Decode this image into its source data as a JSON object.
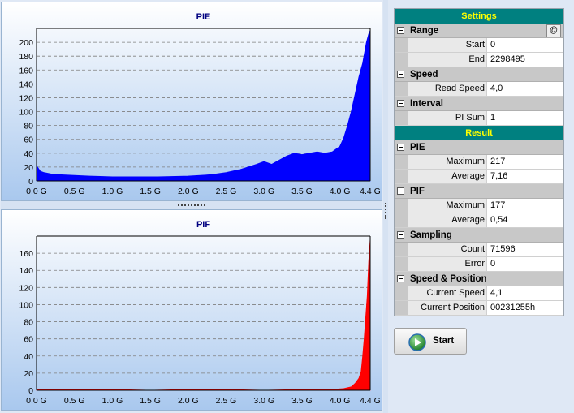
{
  "charts": [
    {
      "id": "pie",
      "title": "PIE",
      "color": "#0000ff",
      "chart_data": {
        "type": "area",
        "title": "PIE",
        "x_ticks": [
          "0.0 G",
          "0.5 G",
          "1.0 G",
          "1.5 G",
          "2.0 G",
          "2.5 G",
          "3.0 G",
          "3.5 G",
          "4.0 G",
          "4.4 G"
        ],
        "y_ticks": [
          "0",
          "20",
          "40",
          "60",
          "80",
          "100",
          "120",
          "140",
          "160",
          "180",
          "200"
        ],
        "xlim": [
          0,
          4.4
        ],
        "ylim": [
          0,
          220
        ],
        "grid": true,
        "series": [
          {
            "x": [
              0,
              0.05,
              0.1,
              0.2,
              0.3,
              0.5,
              0.7,
              1.0,
              1.3,
              1.6,
              2.0,
              2.3,
              2.5,
              2.7,
              2.9,
              3.0,
              3.1,
              3.2,
              3.3,
              3.4,
              3.5,
              3.6,
              3.7,
              3.8,
              3.9,
              4.0,
              4.05,
              4.1,
              4.15,
              4.2,
              4.25,
              4.3,
              4.35,
              4.38,
              4.4
            ],
            "y": [
              22,
              14,
              12,
              10,
              9,
              8,
              7,
              6,
              6,
              6,
              7,
              9,
              12,
              17,
              24,
              28,
              24,
              30,
              36,
              40,
              38,
              40,
              42,
              40,
              42,
              50,
              62,
              80,
              100,
              125,
              150,
              170,
              200,
              212,
              217
            ]
          }
        ]
      }
    },
    {
      "id": "pif",
      "title": "PIF",
      "color": "#ff0000",
      "chart_data": {
        "type": "area",
        "title": "PIF",
        "x_ticks": [
          "0.0 G",
          "0.5 G",
          "1.0 G",
          "1.5 G",
          "2.0 G",
          "2.5 G",
          "3.0 G",
          "3.5 G",
          "4.0 G",
          "4.4 G"
        ],
        "y_ticks": [
          "0",
          "20",
          "40",
          "60",
          "80",
          "100",
          "120",
          "140",
          "160"
        ],
        "xlim": [
          0,
          4.4
        ],
        "ylim": [
          0,
          180
        ],
        "grid": true,
        "series": [
          {
            "x": [
              0,
              0.5,
              1.0,
              1.5,
              2.0,
              2.5,
              3.0,
              3.5,
              3.9,
              4.05,
              4.15,
              4.2,
              4.25,
              4.28,
              4.3,
              4.32,
              4.34,
              4.36,
              4.38,
              4.4
            ],
            "y": [
              1,
              1,
              1,
              0,
              1,
              1,
              0,
              1,
              1,
              2,
              4,
              8,
              14,
              22,
              40,
              60,
              85,
              110,
              150,
              177
            ]
          }
        ]
      }
    }
  ],
  "settings": {
    "header": "Settings",
    "range": {
      "label": "Range",
      "at_button": "@",
      "start_label": "Start",
      "start_value": "0",
      "end_label": "End",
      "end_value": "2298495"
    },
    "speed": {
      "label": "Speed",
      "read_speed_label": "Read Speed",
      "read_speed_value": "4,0"
    },
    "interval": {
      "label": "Interval",
      "pi_sum_label": "PI Sum",
      "pi_sum_value": "1"
    }
  },
  "result": {
    "header": "Result",
    "pie": {
      "label": "PIE",
      "max_label": "Maximum",
      "max_value": "217",
      "avg_label": "Average",
      "avg_value": "7,16"
    },
    "pif": {
      "label": "PIF",
      "max_label": "Maximum",
      "max_value": "177",
      "avg_label": "Average",
      "avg_value": "0,54"
    },
    "sampling": {
      "label": "Sampling",
      "count_label": "Count",
      "count_value": "71596",
      "error_label": "Error",
      "error_value": "0"
    },
    "speed_position": {
      "label": "Speed & Position",
      "current_speed_label": "Current Speed",
      "current_speed_value": "4,1",
      "current_position_label": "Current Position",
      "current_position_value": "00231255h"
    }
  },
  "start_button": {
    "label": "Start",
    "icon": "play-icon",
    "color": "#2e9e2e"
  }
}
